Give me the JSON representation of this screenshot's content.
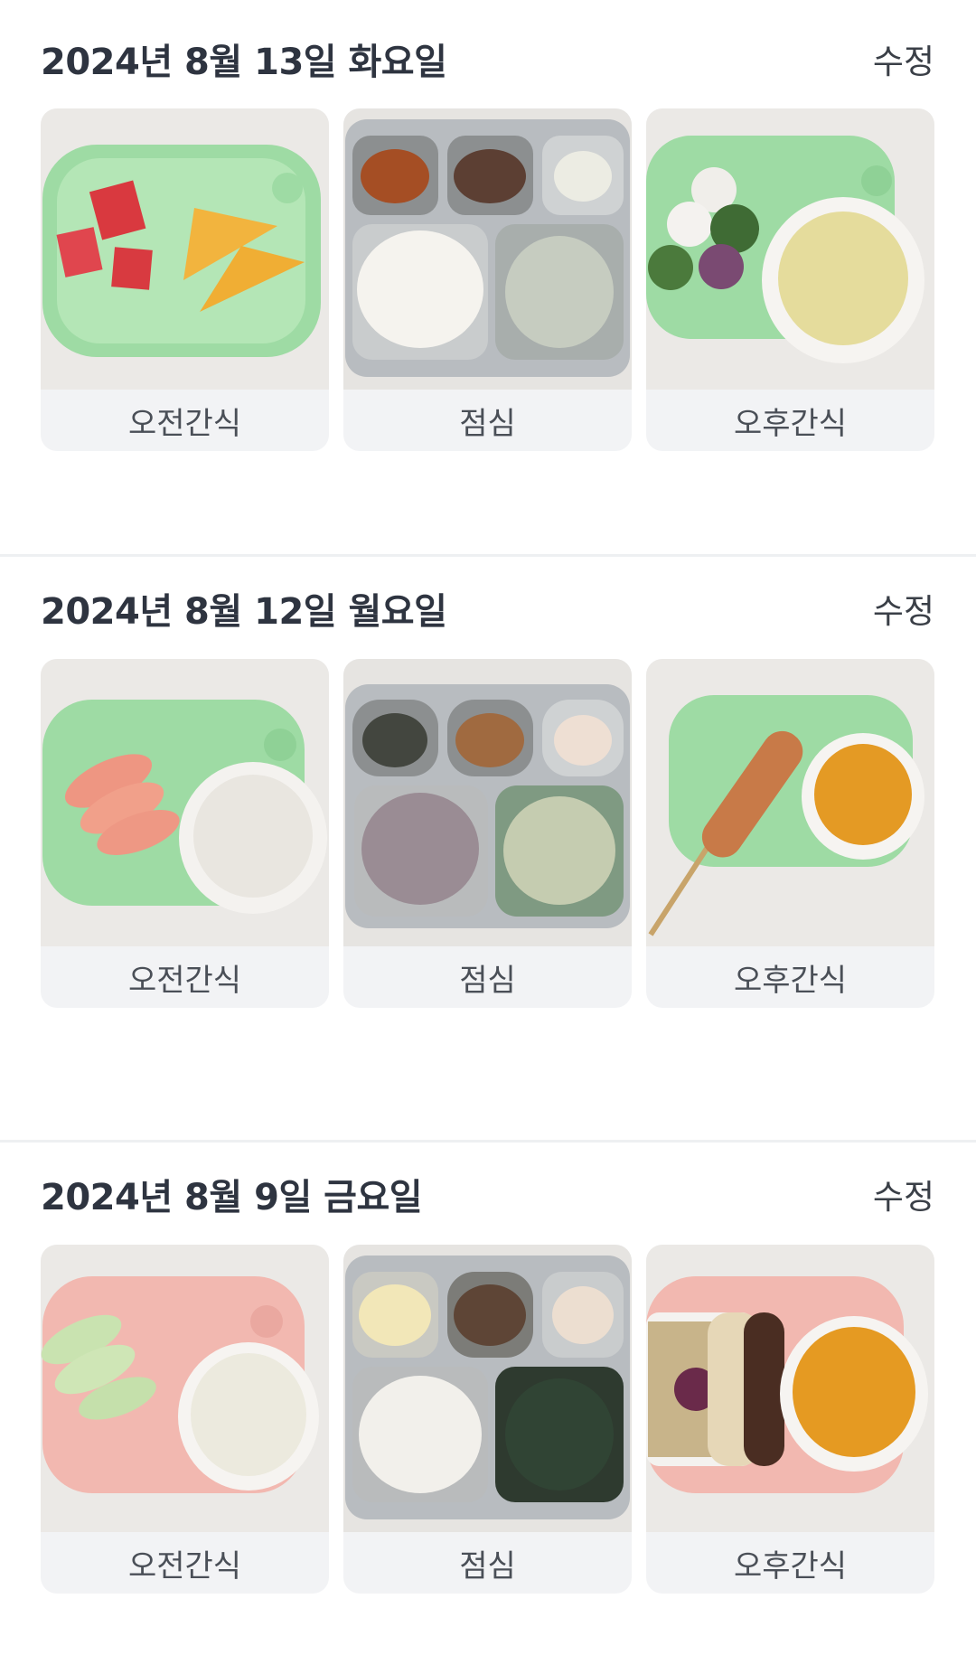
{
  "days": [
    {
      "date": "2024년 8월 13일 화요일",
      "edit_label": "수정",
      "meals": [
        {
          "label": "오전간식",
          "photo": "watermelon-and-melon-snack-photo",
          "tray_color": "#9edba4"
        },
        {
          "label": "점심",
          "photo": "lunch-tray-photo",
          "tray_color": "#b8bcc0"
        },
        {
          "label": "오후간식",
          "photo": "dumplings-and-soup-photo",
          "tray_color": "#9edba4"
        }
      ]
    },
    {
      "date": "2024년 8월 12일 월요일",
      "edit_label": "수정",
      "meals": [
        {
          "label": "오전간식",
          "photo": "peach-and-yogurt-photo",
          "tray_color": "#9edba4"
        },
        {
          "label": "점심",
          "photo": "lunch-tray-photo",
          "tray_color": "#b8bcc0"
        },
        {
          "label": "오후간식",
          "photo": "corndog-and-juice-photo",
          "tray_color": "#9edba4"
        }
      ]
    },
    {
      "date": "2024년 8월 9일 금요일",
      "edit_label": "수정",
      "meals": [
        {
          "label": "오전간식",
          "photo": "apple-and-milk-photo",
          "tray_color": "#f2b8b0"
        },
        {
          "label": "점심",
          "photo": "lunch-tray-photo",
          "tray_color": "#b8bcc0"
        },
        {
          "label": "오후간식",
          "photo": "cake-and-juice-photo",
          "tray_color": "#f2b8b0"
        }
      ]
    }
  ]
}
